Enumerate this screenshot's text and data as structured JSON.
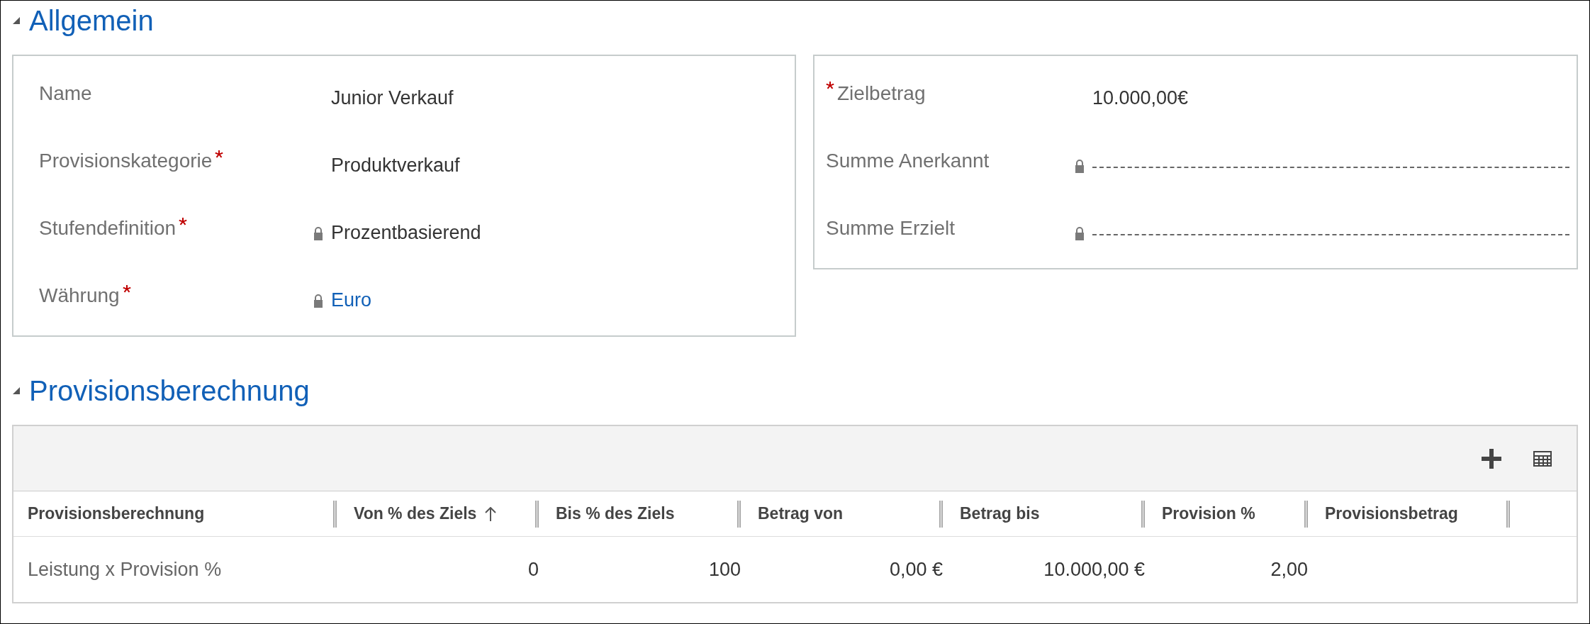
{
  "sections": [
    {
      "title": "Allgemein",
      "expanded": true
    },
    {
      "title": "Provisionsberechnung",
      "expanded": true
    }
  ],
  "general_left": [
    {
      "label": "Name",
      "required": false,
      "locked": false,
      "kind": "text",
      "value": "Junior Verkauf"
    },
    {
      "label": "Provisionskategorie",
      "required": true,
      "locked": false,
      "kind": "text",
      "value": "Produktverkauf"
    },
    {
      "label": "Stufendefinition",
      "required": true,
      "locked": true,
      "kind": "text",
      "value": "Prozentbasierend"
    },
    {
      "label": "Währung",
      "required": true,
      "locked": true,
      "kind": "link",
      "value": "Euro"
    }
  ],
  "general_right": [
    {
      "label": "Zielbetrag",
      "required": true,
      "locked": false,
      "kind": "text",
      "value": "10.000,00€"
    },
    {
      "label": "Summe Anerkannt",
      "required": false,
      "locked": true,
      "kind": "empty"
    },
    {
      "label": "Summe Erzielt",
      "required": false,
      "locked": true,
      "kind": "empty"
    }
  ],
  "grid": {
    "columns": [
      {
        "label": "Provisionsberechnung",
        "sorted": false
      },
      {
        "label": "Von % des Ziels",
        "sorted": true
      },
      {
        "label": "Bis % des Ziels",
        "sorted": false
      },
      {
        "label": "Betrag von",
        "sorted": false
      },
      {
        "label": "Betrag bis",
        "sorted": false
      },
      {
        "label": "Provision %",
        "sorted": false
      },
      {
        "label": "Provisionsbetrag",
        "sorted": false
      }
    ],
    "rows": [
      [
        "Leistung x Provision %",
        "0",
        "100",
        "0,00 €",
        "10.000,00 €",
        "2,00",
        ""
      ]
    ]
  }
}
